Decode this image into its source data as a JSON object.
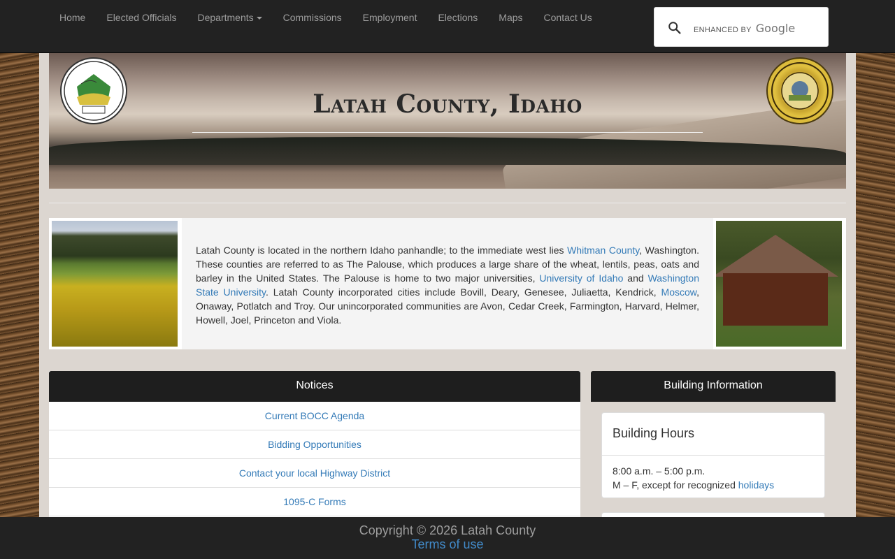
{
  "nav": {
    "items": [
      {
        "label": "Home"
      },
      {
        "label": "Elected Officials"
      },
      {
        "label": "Departments",
        "dropdown": true
      },
      {
        "label": "Commissions"
      },
      {
        "label": "Employment"
      },
      {
        "label": "Elections"
      },
      {
        "label": "Maps"
      },
      {
        "label": "Contact Us"
      }
    ],
    "search": {
      "brand_prefix": "ENHANCED BY",
      "brand_name": "Google",
      "icon": "search-icon"
    }
  },
  "banner": {
    "title": "Latah County, Idaho",
    "seal_left": "Latah County Idaho 1888",
    "seal_right": "Great Seal of the State of Idaho"
  },
  "intro": {
    "t1": "Latah County is located in the northern Idaho panhandle; to the immediate west lies ",
    "l1": "Whitman County",
    "t2": ", Washington. These counties are referred to as The Palouse, which produces a large share of the wheat, lentils, peas, oats and barley in the United States. The Palouse is home to two major universities, ",
    "l2": "University of Idaho",
    "t3": " and ",
    "l3": "Washington State University",
    "t4": ". Latah County incorporated cities include Bovill, Deary, Genesee, Juliaetta, Kendrick, ",
    "l4": "Moscow",
    "t5": ", Onaway, Potlatch and Troy. Our unincorporated communities are Avon, Cedar Creek, Farmington, Harvard, Helmer, Howell, Joel, Princeton and Viola."
  },
  "notices": {
    "title": "Notices",
    "items": [
      {
        "label": "Current BOCC Agenda"
      },
      {
        "label": "Bidding Opportunities"
      },
      {
        "label": "Contact your local Highway District"
      },
      {
        "label": "1095-C Forms"
      }
    ]
  },
  "building": {
    "title": "Building Information",
    "card_title": "Building Hours",
    "hours": "8:00 a.m. – 5:00 p.m.",
    "days_prefix": "M – F, except for recognized ",
    "holidays_link": "holidays"
  },
  "footer": {
    "copyright": "Copyright © 2026 Latah County",
    "terms": "Terms of use"
  },
  "colors": {
    "navbar": "#222222",
    "link": "#337ab7",
    "panel_header": "#1e1e1e"
  }
}
